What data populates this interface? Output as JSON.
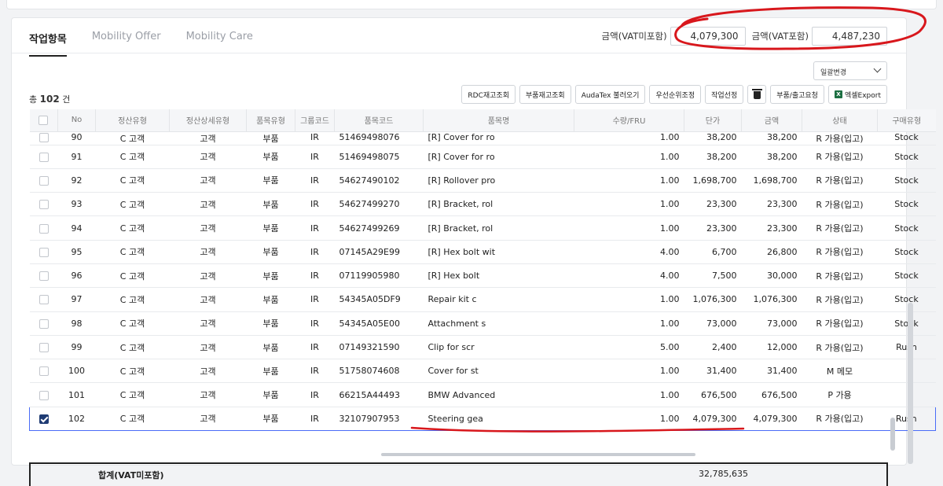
{
  "tabs": [
    {
      "label": "작업항목",
      "active": true
    },
    {
      "label": "Mobility Offer",
      "active": false
    },
    {
      "label": "Mobility Care",
      "active": false
    }
  ],
  "amounts": {
    "excl_label": "금액(VAT미포함)",
    "excl_value": "4,079,300",
    "incl_label": "금액(VAT포함)",
    "incl_value": "4,487,230"
  },
  "select": {
    "value": "일괄변경"
  },
  "count": {
    "prefix": "총",
    "value": "102",
    "suffix": "건"
  },
  "toolbar": {
    "rdc": "RDC재고조회",
    "parts_stock": "부품재고조회",
    "audatex": "AudaTex 불러오기",
    "priority": "우선순위조정",
    "job_select": "작업선정",
    "parts_request": "부품/출고요청",
    "excel": "엑셀Export",
    "excel_icon_text": "X"
  },
  "columns": [
    "",
    "No",
    "정산유형",
    "정산상세유형",
    "품목유형",
    "그룹코드",
    "품목코드",
    "품목명",
    "수량/FRU",
    "단가",
    "금액",
    "상태",
    "구매유형"
  ],
  "rows": [
    {
      "checked": false,
      "no": "90",
      "settle": "C 고객",
      "detail": "고객",
      "type": "부품",
      "group": "IR",
      "code": "51469498076",
      "name": "[R] Cover for ro",
      "qty": "1.00",
      "price": "38,200",
      "amount": "38,200",
      "status": "R 가용(입고)",
      "buy": "Stock"
    },
    {
      "checked": false,
      "no": "91",
      "settle": "C 고객",
      "detail": "고객",
      "type": "부품",
      "group": "IR",
      "code": "51469498075",
      "name": "[R] Cover for ro",
      "qty": "1.00",
      "price": "38,200",
      "amount": "38,200",
      "status": "R 가용(입고)",
      "buy": "Stock"
    },
    {
      "checked": false,
      "no": "92",
      "settle": "C 고객",
      "detail": "고객",
      "type": "부품",
      "group": "IR",
      "code": "54627490102",
      "name": "[R] Rollover pro",
      "qty": "1.00",
      "price": "1,698,700",
      "amount": "1,698,700",
      "status": "R 가용(입고)",
      "buy": "Stock"
    },
    {
      "checked": false,
      "no": "93",
      "settle": "C 고객",
      "detail": "고객",
      "type": "부품",
      "group": "IR",
      "code": "54627499270",
      "name": "[R] Bracket, rol",
      "qty": "1.00",
      "price": "23,300",
      "amount": "23,300",
      "status": "R 가용(입고)",
      "buy": "Stock"
    },
    {
      "checked": false,
      "no": "94",
      "settle": "C 고객",
      "detail": "고객",
      "type": "부품",
      "group": "IR",
      "code": "54627499269",
      "name": "[R] Bracket, rol",
      "qty": "1.00",
      "price": "23,300",
      "amount": "23,300",
      "status": "R 가용(입고)",
      "buy": "Stock"
    },
    {
      "checked": false,
      "no": "95",
      "settle": "C 고객",
      "detail": "고객",
      "type": "부품",
      "group": "IR",
      "code": "07145A29E99",
      "name": "[R] Hex bolt wit",
      "qty": "4.00",
      "price": "6,700",
      "amount": "26,800",
      "status": "R 가용(입고)",
      "buy": "Stock"
    },
    {
      "checked": false,
      "no": "96",
      "settle": "C 고객",
      "detail": "고객",
      "type": "부품",
      "group": "IR",
      "code": "07119905980",
      "name": "[R] Hex bolt",
      "qty": "4.00",
      "price": "7,500",
      "amount": "30,000",
      "status": "R 가용(입고)",
      "buy": "Stock"
    },
    {
      "checked": false,
      "no": "97",
      "settle": "C 고객",
      "detail": "고객",
      "type": "부품",
      "group": "IR",
      "code": "54345A05DF9",
      "name": "Repair kit c",
      "qty": "1.00",
      "price": "1,076,300",
      "amount": "1,076,300",
      "status": "R 가용(입고)",
      "buy": "Stock"
    },
    {
      "checked": false,
      "no": "98",
      "settle": "C 고객",
      "detail": "고객",
      "type": "부품",
      "group": "IR",
      "code": "54345A05E00",
      "name": "Attachment s",
      "qty": "1.00",
      "price": "73,000",
      "amount": "73,000",
      "status": "R 가용(입고)",
      "buy": "Stock"
    },
    {
      "checked": false,
      "no": "99",
      "settle": "C 고객",
      "detail": "고객",
      "type": "부품",
      "group": "IR",
      "code": "07149321590",
      "name": "Clip for scr",
      "qty": "5.00",
      "price": "2,400",
      "amount": "12,000",
      "status": "R 가용(입고)",
      "buy": "Rush"
    },
    {
      "checked": false,
      "no": "100",
      "settle": "C 고객",
      "detail": "고객",
      "type": "부품",
      "group": "IR",
      "code": "51758074608",
      "name": "Cover for st",
      "qty": "1.00",
      "price": "31,400",
      "amount": "31,400",
      "status": "M 메모",
      "buy": ""
    },
    {
      "checked": false,
      "no": "101",
      "settle": "C 고객",
      "detail": "고객",
      "type": "부품",
      "group": "IR",
      "code": "66215A44493",
      "name": "BMW Advanced",
      "qty": "1.00",
      "price": "676,500",
      "amount": "676,500",
      "status": "P 가용",
      "buy": ""
    },
    {
      "checked": true,
      "no": "102",
      "settle": "C 고객",
      "detail": "고객",
      "type": "부품",
      "group": "IR",
      "code": "32107907953",
      "name": "Steering gea",
      "qty": "1.00",
      "price": "4,079,300",
      "amount": "4,079,300",
      "status": "R 가용(입고)",
      "buy": "Rush"
    }
  ],
  "total": {
    "label": "합계(VAT미포함)",
    "value": "32,785,635"
  }
}
